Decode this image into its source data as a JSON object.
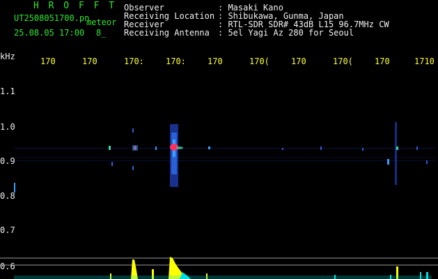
{
  "header": {
    "program": "H R O F F T",
    "file_name": "UT2508051700.pn",
    "file_type": "meteor",
    "datetime": "25.08.05 17:00",
    "count": "8_",
    "rows": [
      {
        "label": "Observer",
        "value": ": Masaki Kano"
      },
      {
        "label": "Receiving Location",
        "value": ": Shibukawa, Gunma, Japan"
      },
      {
        "label": "Receiver",
        "value": ": RTL-SDR SDR# 43dB L15 96.7MHz CW"
      },
      {
        "label": "Receiving Antenna",
        "value": ": 5el Yagi Az 280 for Seoul"
      }
    ]
  },
  "time_axis": [
    "170",
    "170",
    "170:",
    "170:",
    "170",
    "170(",
    "170",
    "170(",
    "170",
    "1710"
  ],
  "freq_axis": {
    "unit": "kHz",
    "labels": [
      "1.1",
      "1.0",
      "0.9",
      "0.8",
      "0.7",
      "0.6"
    ]
  },
  "colors": {
    "background": "#000000",
    "text_header": "#2ee82e",
    "text_info": "#f2f2f2",
    "ticks": "#ffff33",
    "grid": "#9a9a9a",
    "echo_core": "#ff3060",
    "echo_mid": "#3aa0ff",
    "echo_faint": "#1c3aa8",
    "bars": "#ffff00",
    "bars_cyan": "#00e0e0"
  }
}
